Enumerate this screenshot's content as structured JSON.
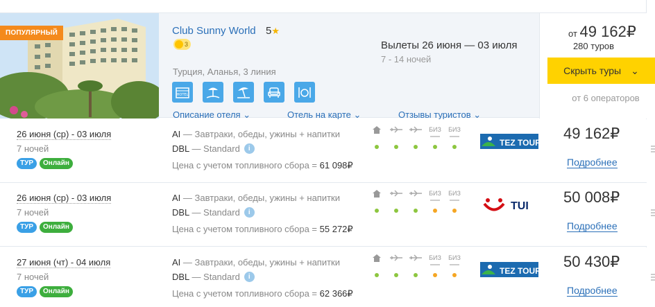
{
  "hotel": {
    "badge": "ПОПУЛЯРНЫЙ",
    "name": "Club Sunny World",
    "stars": "5",
    "rating_score": "3",
    "location": "Турция, Аланья, 3 линия",
    "amenities": [
      "hotel-icon",
      "beach-icon",
      "beach-umbrella-icon",
      "armchair-icon",
      "restaurant-icon"
    ],
    "amenity_hotel_label": "HOTEL",
    "links": {
      "description": "Описание отеля",
      "map": "Отель на карте",
      "reviews": "Отзывы туристов"
    },
    "dates": "Вылеты 26 июня — 03 июля",
    "nights": "7 - 14 ночей",
    "price_prefix": "от",
    "price": "49 162₽",
    "tours_count": "280 туров",
    "hide_button": "Скрыть туры",
    "operators": "от 6 операторов"
  },
  "labels": {
    "details": "Подробнее",
    "fuel_prefix": "Цена с учетом топливного сбора =",
    "biz": "БИЗ",
    "tag_tur": "ТУР",
    "tag_online": "Онлайн"
  },
  "tours": [
    {
      "dates": "26 июня (ср) - 03 июля",
      "nights": "7 ночей",
      "meal_code": "AI",
      "meal_desc": "— Завтраки, обеды, ужины + напитки",
      "room_code": "DBL",
      "room_desc": "— Standard",
      "fuel_price": "61 098₽",
      "operator": "TEZ TOUR",
      "operator_tag": "tour",
      "price": "49 162₽",
      "dots": [
        "green",
        "green",
        "green",
        "green",
        "green"
      ]
    },
    {
      "dates": "26 июня (ср) - 03 июля",
      "nights": "7 ночей",
      "meal_code": "AI",
      "meal_desc": "— Завтраки, обеды, ужины + напитки",
      "room_code": "DBL",
      "room_desc": "— Standard",
      "fuel_price": "55 272₽",
      "operator": "TUI",
      "operator_tag": "",
      "price": "50 008₽",
      "dots": [
        "green",
        "green",
        "green",
        "orange",
        "orange"
      ]
    },
    {
      "dates": "27 июня (чт) - 04 июля",
      "nights": "7 ночей",
      "meal_code": "AI",
      "meal_desc": "— Завтраки, обеды, ужины + напитки",
      "room_code": "DBL",
      "room_desc": "— Standard",
      "fuel_price": "62 366₽",
      "operator": "TEZ TOUR",
      "operator_tag": "tour",
      "price": "50 430₽",
      "dots": [
        "green",
        "green",
        "green",
        "orange",
        "orange"
      ]
    }
  ],
  "colors": {
    "accent": "#2a6fb8",
    "button": "#ffd200",
    "badge": "#f48a1c",
    "tag_tur": "#3aa0e6",
    "tag_online": "#3dae3d",
    "dot_green": "#8dc63f",
    "dot_orange": "#f5a623"
  }
}
